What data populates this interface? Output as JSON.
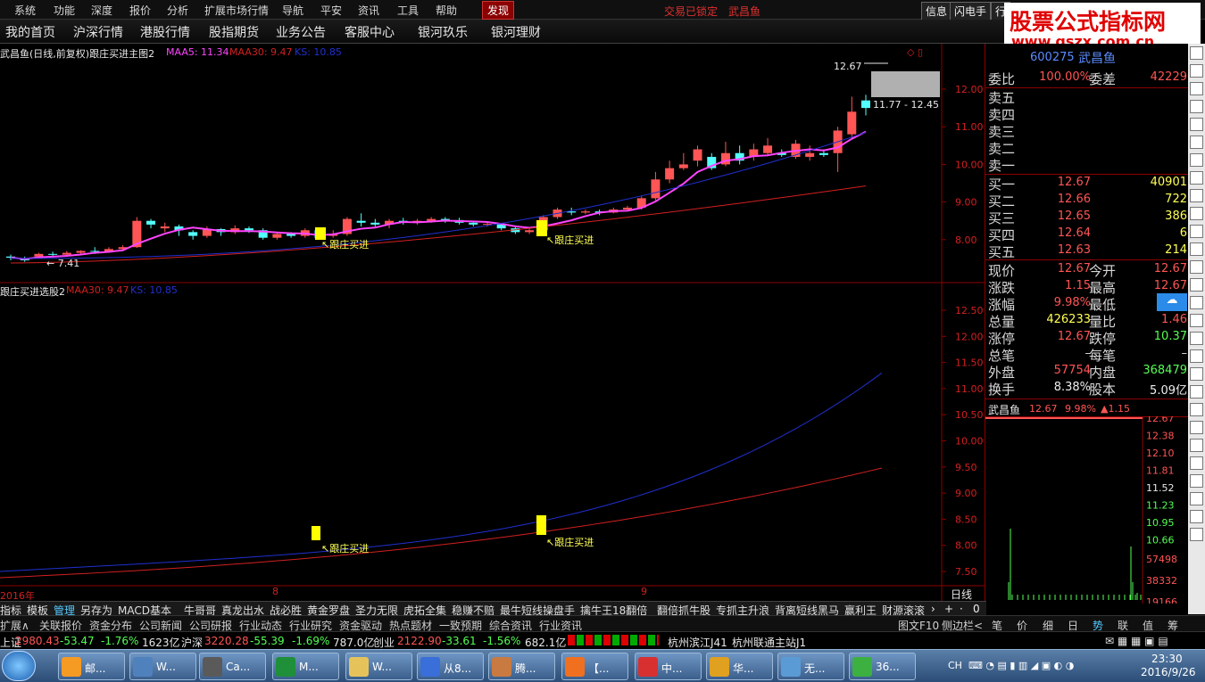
{
  "menu": {
    "items": [
      "系统",
      "功能",
      "深度",
      "报价",
      "分析",
      "扩展市场行情",
      "导航",
      "平安",
      "资讯",
      "工具",
      "帮助",
      "发现"
    ],
    "right_status": "交易已锁定",
    "right_stock": "武昌鱼",
    "buttons": [
      "信息",
      "闪电手",
      "行"
    ]
  },
  "nav": {
    "items": [
      "我的首页",
      "沪深行情",
      "港股行情",
      "股指期货",
      "业务公告",
      "客服中心",
      "银河玖乐",
      "银河理财"
    ]
  },
  "watermark": {
    "line1": "股票公式指标网",
    "line2": "www.gszx.com.cn"
  },
  "main_chart": {
    "title": "武昌鱼(日线,前复权)跟庄买进主图2",
    "ma5": "MAA5: 11.34",
    "ma30": "MAA30: 9.47",
    "ks": "KS: 10.85",
    "high_label": "12.67",
    "range_label": "11.77 - 12.45",
    "low_label": "7.41",
    "signal": "跟庄买进",
    "yticks": [
      "12.00",
      "11.00",
      "10.00",
      "9.00",
      "8.00"
    ]
  },
  "sub_chart": {
    "title": "跟庄买进选股2",
    "ma30": "MAA30: 9.47",
    "ks": "KS: 10.85",
    "signal": "跟庄买进",
    "yticks": [
      "12.50",
      "12.00",
      "11.50",
      "11.00",
      "10.50",
      "10.00",
      "9.50",
      "9.00",
      "8.50",
      "8.00",
      "7.50"
    ]
  },
  "xaxis": {
    "labels": [
      "2016年",
      "8",
      "9"
    ],
    "period": "日线"
  },
  "quote": {
    "code": "600275",
    "name": "武昌鱼",
    "weibi": {
      "label": "委比",
      "value": "100.00%",
      "label2": "委差",
      "value2": "42229"
    },
    "sells": [
      "卖五",
      "卖四",
      "卖三",
      "卖二",
      "卖一"
    ],
    "buys": [
      {
        "label": "买一",
        "price": "12.67",
        "vol": "40901"
      },
      {
        "label": "买二",
        "price": "12.66",
        "vol": "722"
      },
      {
        "label": "买三",
        "price": "12.65",
        "vol": "386"
      },
      {
        "label": "买四",
        "price": "12.64",
        "vol": "6"
      },
      {
        "label": "买五",
        "price": "12.63",
        "vol": "214"
      }
    ],
    "stats": [
      {
        "l1": "现价",
        "v1": "12.67",
        "l2": "今开",
        "v2": "12.67"
      },
      {
        "l1": "涨跌",
        "v1": "1.15",
        "l2": "最高",
        "v2": "12.67"
      },
      {
        "l1": "涨幅",
        "v1": "9.98%",
        "l2": "最低",
        "v2": ""
      },
      {
        "l1": "总量",
        "v1": "426233",
        "l2": "量比",
        "v2": "1.46"
      },
      {
        "l1": "涨停",
        "v1": "12.67",
        "l2": "跌停",
        "v2": "10.37"
      },
      {
        "l1": "总笔",
        "v1": "–",
        "l2": "每笔",
        "v2": "–"
      },
      {
        "l1": "外盘",
        "v1": "57754",
        "l2": "内盘",
        "v2": "368479"
      },
      {
        "l1": "换手",
        "v1": "8.38%",
        "l2": "股本",
        "v2": "5.09亿"
      }
    ],
    "mini": {
      "name": "武昌鱼",
      "price": "12.67",
      "pct": "9.98%",
      "chg": "▲1.15",
      "prices": [
        "12.67",
        "12.38",
        "12.10",
        "11.81",
        "11.52",
        "11.23",
        "10.95",
        "10.66"
      ],
      "vols": [
        "57498",
        "38332",
        "19166"
      ]
    }
  },
  "tabs1": [
    "指标",
    "模板",
    "管理",
    "另存为",
    "MACD基本",
    "牛哥哥",
    "真龙出水",
    "战必胜",
    "黄金罗盘",
    "圣力无限",
    "虎拓全集",
    "稳赚不赔",
    "最牛短线操盘手",
    "擒牛王18翻倍",
    "翻倍抓牛股",
    "专抓主升浪",
    "背离短线黑马",
    "赢利王",
    "财源滚滚"
  ],
  "tabs2": [
    "扩展∧",
    "关联报价",
    "资金分布",
    "公司新闻",
    "公司研报",
    "行业动态",
    "行业研究",
    "资金驱动",
    "热点题材",
    "一致预期",
    "综合资讯",
    "行业资讯",
    "图文F10",
    "侧边栏<"
  ],
  "tabs2_right": [
    "笔",
    "价",
    "细",
    "日",
    "势",
    "联",
    "值",
    "筹"
  ],
  "status": {
    "sh_label": "上证",
    "sh": "2980.43",
    "sh_chg": "-53.47",
    "sh_pct": "-1.76%",
    "sh_amt": "1623亿",
    "sz_label": "沪深",
    "sz": "3220.28",
    "sz_chg": "-55.39",
    "sz_pct": "-1.69%",
    "sz_amt": "787.0亿",
    "cy_label": "创业",
    "cy": "2122.90",
    "cy_chg": "-33.61",
    "cy_pct": "-1.56%",
    "cy_amt": "682.1亿",
    "server1": "杭州滨江J41",
    "server2": "杭州联通主站J1"
  },
  "taskbar": {
    "items": [
      "邮...",
      "W...",
      "Ca...",
      "M...",
      "W...",
      "从8...",
      "腾...",
      "【...",
      "中...",
      "华...",
      "无...",
      "36..."
    ],
    "lang": "CH",
    "time": "23:30",
    "date": "2016/9/26"
  },
  "colors": {
    "up": "#ff5555",
    "down": "#54ffff",
    "ma5": "#ff44ff",
    "ma30": "#d22020",
    "ks": "#2030d0",
    "signal": "#ffff00"
  }
}
